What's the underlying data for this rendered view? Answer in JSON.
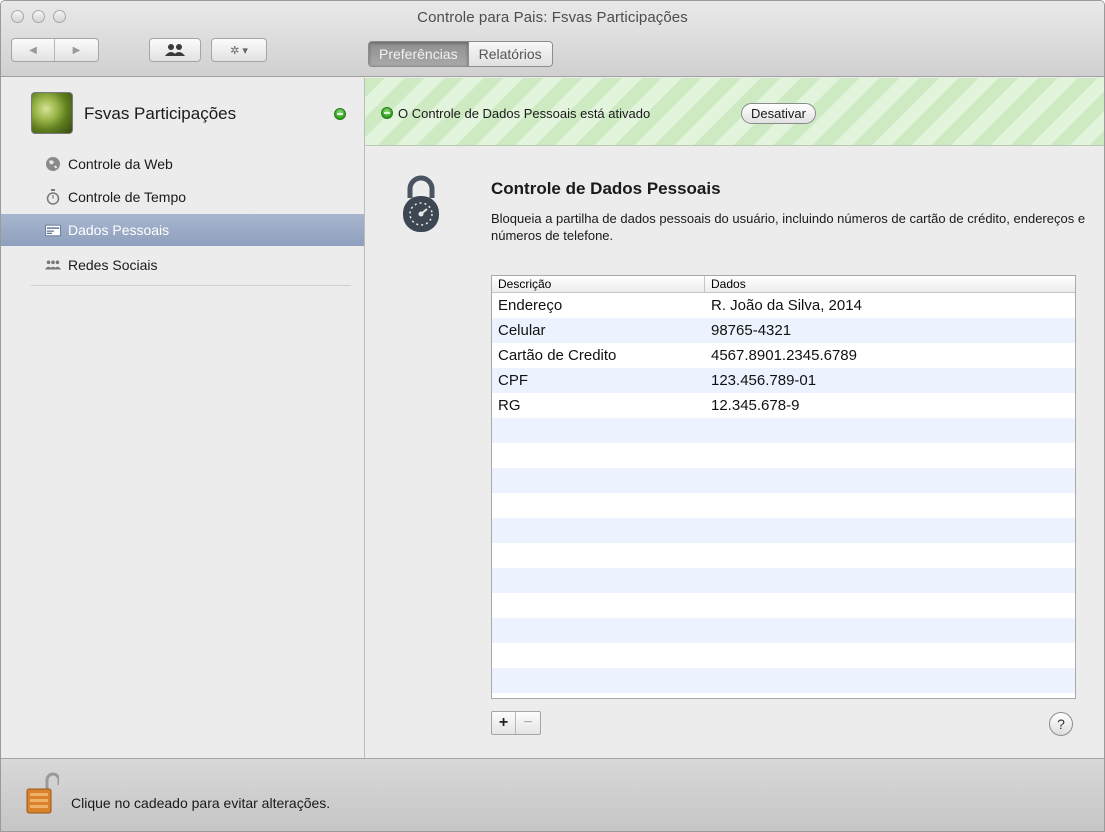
{
  "window": {
    "title": "Controle para Pais: Fsvas Participações"
  },
  "toolbar": {
    "back_glyph": "◀",
    "forward_glyph": "▶",
    "people_glyph": "👥",
    "gear_glyph": "✲ ▾",
    "tabs": [
      {
        "label": "Preferências",
        "active": true
      },
      {
        "label": "Relatórios",
        "active": false
      }
    ]
  },
  "sidebar": {
    "account_name": "Fsvas Participações",
    "account_status": "enabled",
    "items": [
      {
        "label": "Controle da Web",
        "icon": "globe-icon",
        "selected": false
      },
      {
        "label": "Controle de Tempo",
        "icon": "stopwatch-icon",
        "selected": false
      },
      {
        "label": "Dados Pessoais",
        "icon": "id-card-icon",
        "selected": true
      },
      {
        "label": "Redes Sociais",
        "icon": "people-icon",
        "selected": false
      }
    ]
  },
  "status": {
    "text": "O Controle de Dados Pessoais está ativado",
    "button_label": "Desativar"
  },
  "panel": {
    "title": "Controle de Dados Pessoais",
    "description": "Bloqueia a partilha de dados pessoais do usuário, incluindo números de cartão de crédito, endereços e números de telefone."
  },
  "table": {
    "headers": [
      "Descrição",
      "Dados"
    ],
    "rows": [
      [
        "Endereço",
        "R. João da Silva, 2014"
      ],
      [
        "Celular",
        "98765-4321"
      ],
      [
        "Cartão de Credito",
        "4567.8901.2345.6789"
      ],
      [
        "CPF",
        "123.456.789-01"
      ],
      [
        "RG",
        "12.345.678-9"
      ]
    ]
  },
  "controls": {
    "add_label": "+",
    "remove_label": "−",
    "help_label": "?"
  },
  "footer": {
    "text": "Clique no cadeado para evitar alterações."
  },
  "colors": {
    "selection": "#97a7c3",
    "status_green": "#34a12a",
    "stripe_light": "#e3f4dc",
    "stripe_dark": "#cdeac3"
  }
}
